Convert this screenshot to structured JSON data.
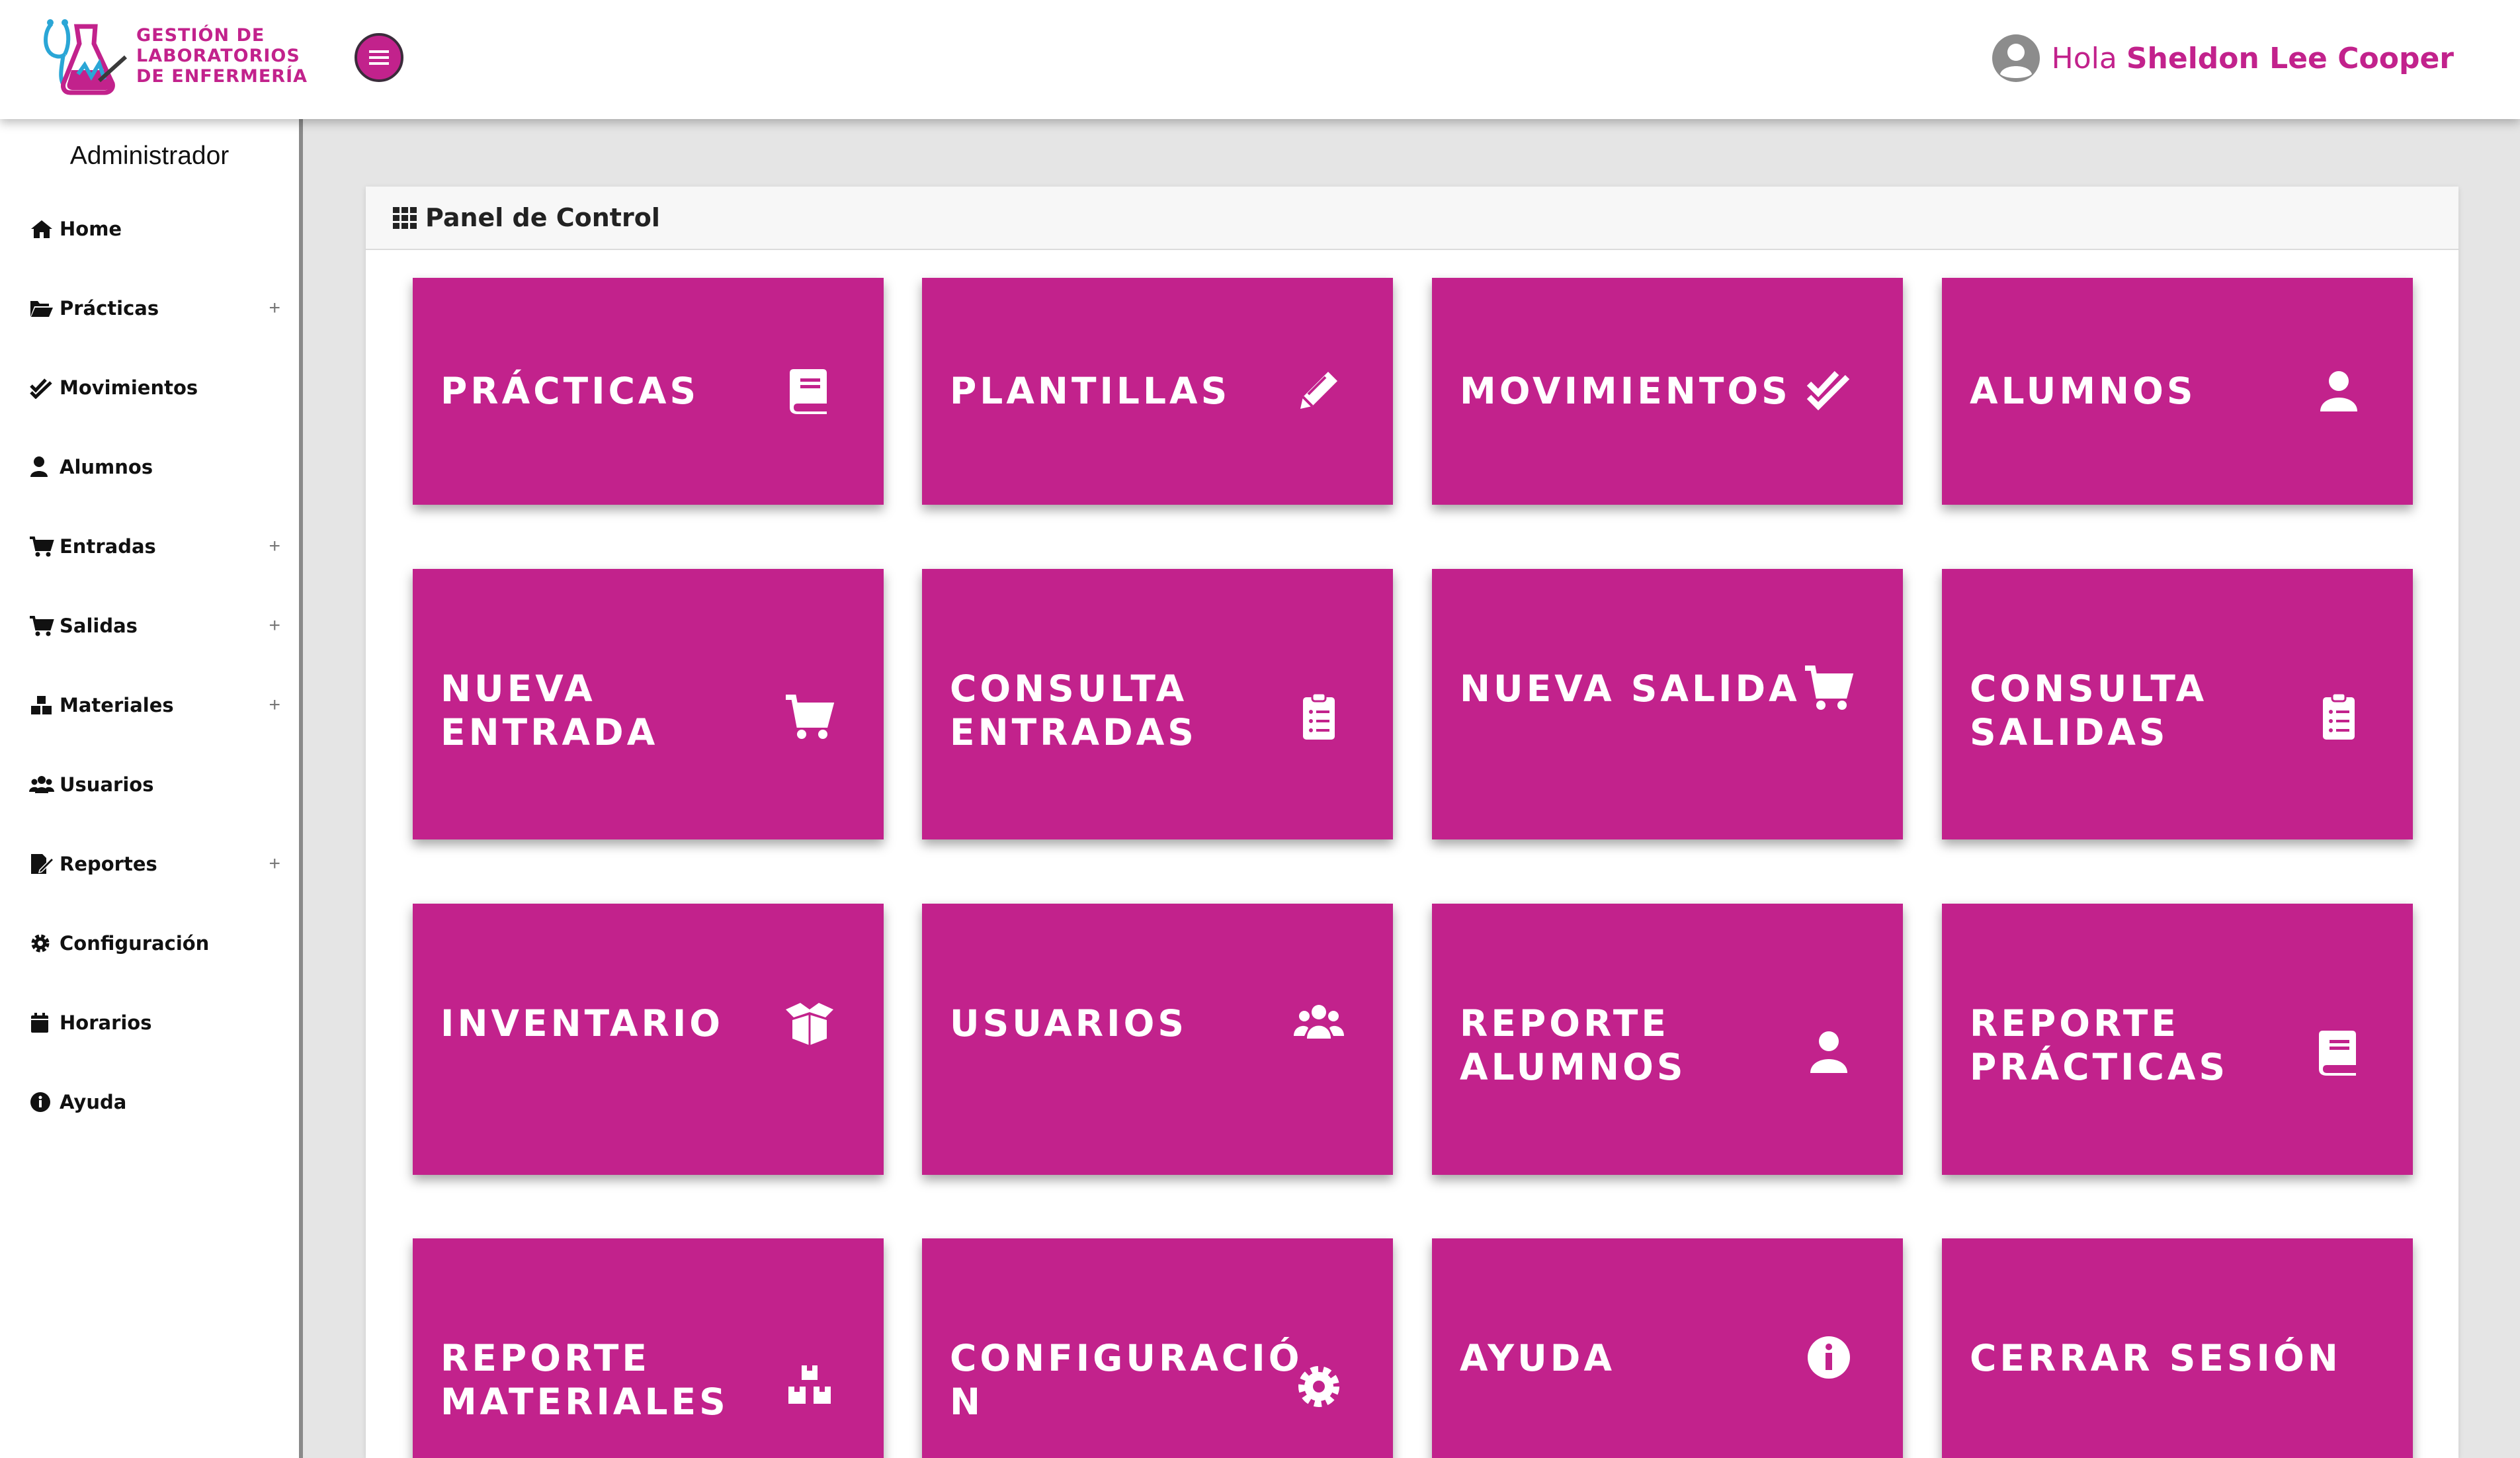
{
  "header": {
    "brand_line1": "GESTIÓN DE",
    "brand_line2": "LABORATORIOS",
    "brand_line3": "DE ENFERMERÍA",
    "greeting": "Hola",
    "user_name": "Sheldon Lee Cooper",
    "accent_color": "#c2228c"
  },
  "sidebar": {
    "role": "Administrador",
    "items": [
      {
        "label": "Home",
        "icon": "home-icon",
        "expandable": false
      },
      {
        "label": "Prácticas",
        "icon": "folder-open-icon",
        "expandable": true,
        "plus": "+"
      },
      {
        "label": "Movimientos",
        "icon": "check-double-icon",
        "expandable": false
      },
      {
        "label": "Alumnos",
        "icon": "user-icon",
        "expandable": false
      },
      {
        "label": "Entradas",
        "icon": "cart-icon",
        "expandable": true,
        "plus": "+"
      },
      {
        "label": "Salidas",
        "icon": "cart-icon",
        "expandable": true,
        "plus": "+"
      },
      {
        "label": "Materiales",
        "icon": "boxes-icon",
        "expandable": true,
        "plus": "+"
      },
      {
        "label": "Usuarios",
        "icon": "users-icon",
        "expandable": false
      },
      {
        "label": "Reportes",
        "icon": "file-signature-icon",
        "expandable": true,
        "plus": "+"
      },
      {
        "label": "Configuración",
        "icon": "gear-icon",
        "expandable": false
      },
      {
        "label": "Horarios",
        "icon": "calendar-icon",
        "expandable": false
      },
      {
        "label": "Ayuda",
        "icon": "info-icon",
        "expandable": false
      }
    ]
  },
  "panel": {
    "title": "Panel de Control",
    "tiles": [
      {
        "label": "PRÁCTICAS",
        "icon": "book-icon"
      },
      {
        "label": "PLANTILLAS",
        "icon": "pencil-icon"
      },
      {
        "label": "MOVIMIENTOS",
        "icon": "check-double-icon"
      },
      {
        "label": "ALUMNOS",
        "icon": "user-icon"
      },
      {
        "label": "NUEVA\nENTRADA",
        "icon": "cart-icon"
      },
      {
        "label": "CONSULTA\nENTRADAS",
        "icon": "clipboard-list-icon"
      },
      {
        "label": "NUEVA SALIDA",
        "icon": "cart-icon"
      },
      {
        "label": "CONSULTA\nSALIDAS",
        "icon": "clipboard-list-icon"
      },
      {
        "label": "INVENTARIO",
        "icon": "box-open-icon"
      },
      {
        "label": "USUARIOS",
        "icon": "users-icon"
      },
      {
        "label": "REPORTE\nALUMNOS",
        "icon": "user-icon"
      },
      {
        "label": "REPORTE\nPRÁCTICAS",
        "icon": "book-icon"
      },
      {
        "label": "REPORTE\nMATERIALES",
        "icon": "boxes-icon"
      },
      {
        "label": "CONFIGURACIÓ\nN",
        "icon": "gear-icon"
      },
      {
        "label": "AYUDA",
        "icon": "info-icon"
      },
      {
        "label": "CERRAR SESIÓN",
        "icon": ""
      }
    ]
  }
}
